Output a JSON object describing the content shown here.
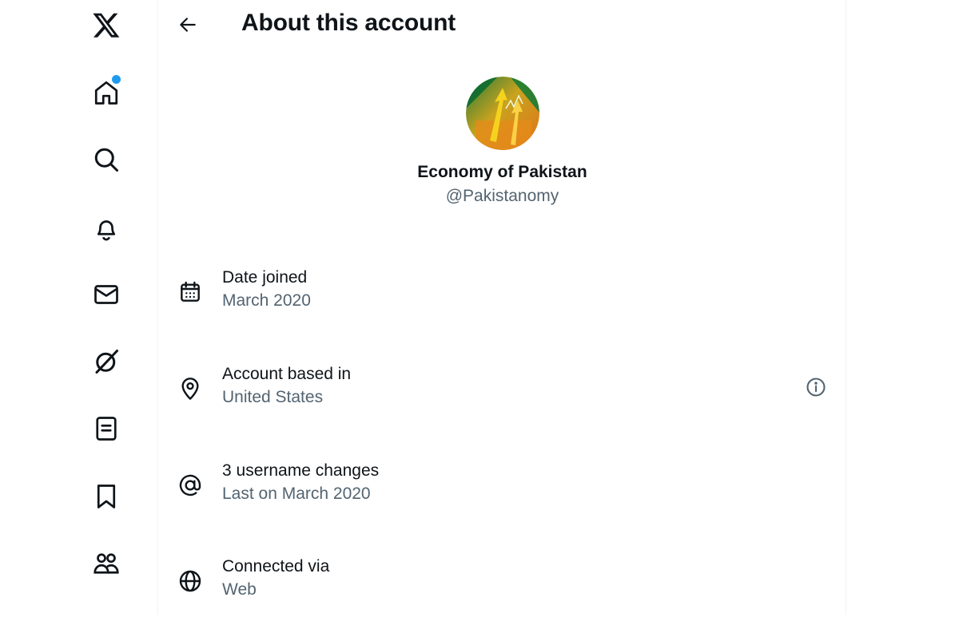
{
  "app": {
    "brand": "X"
  },
  "nav": {
    "items": [
      {
        "name": "x-logo-icon"
      },
      {
        "name": "home-icon",
        "has_notification_dot": true
      },
      {
        "name": "search-icon"
      },
      {
        "name": "bell-icon"
      },
      {
        "name": "mail-icon"
      },
      {
        "name": "grok-icon"
      },
      {
        "name": "list-icon"
      },
      {
        "name": "bookmark-icon"
      },
      {
        "name": "communities-icon"
      }
    ],
    "accent_color": "#1d9bf0"
  },
  "header": {
    "title": "About this account"
  },
  "profile": {
    "display_name": "Economy of Pakistan",
    "handle": "@Pakistanomy"
  },
  "details": [
    {
      "icon": "calendar-icon",
      "label": "Date joined",
      "value": "March 2020"
    },
    {
      "icon": "location-pin-icon",
      "label": "Account based in",
      "value": "United States",
      "info_icon": true
    },
    {
      "icon": "at-sign-icon",
      "label": "3 username changes",
      "value": "Last on March 2020"
    },
    {
      "icon": "globe-icon",
      "label": "Connected via",
      "value": "Web"
    }
  ],
  "colors": {
    "text_primary": "#0f1419",
    "text_secondary": "#536471",
    "border": "#eff3f4"
  }
}
